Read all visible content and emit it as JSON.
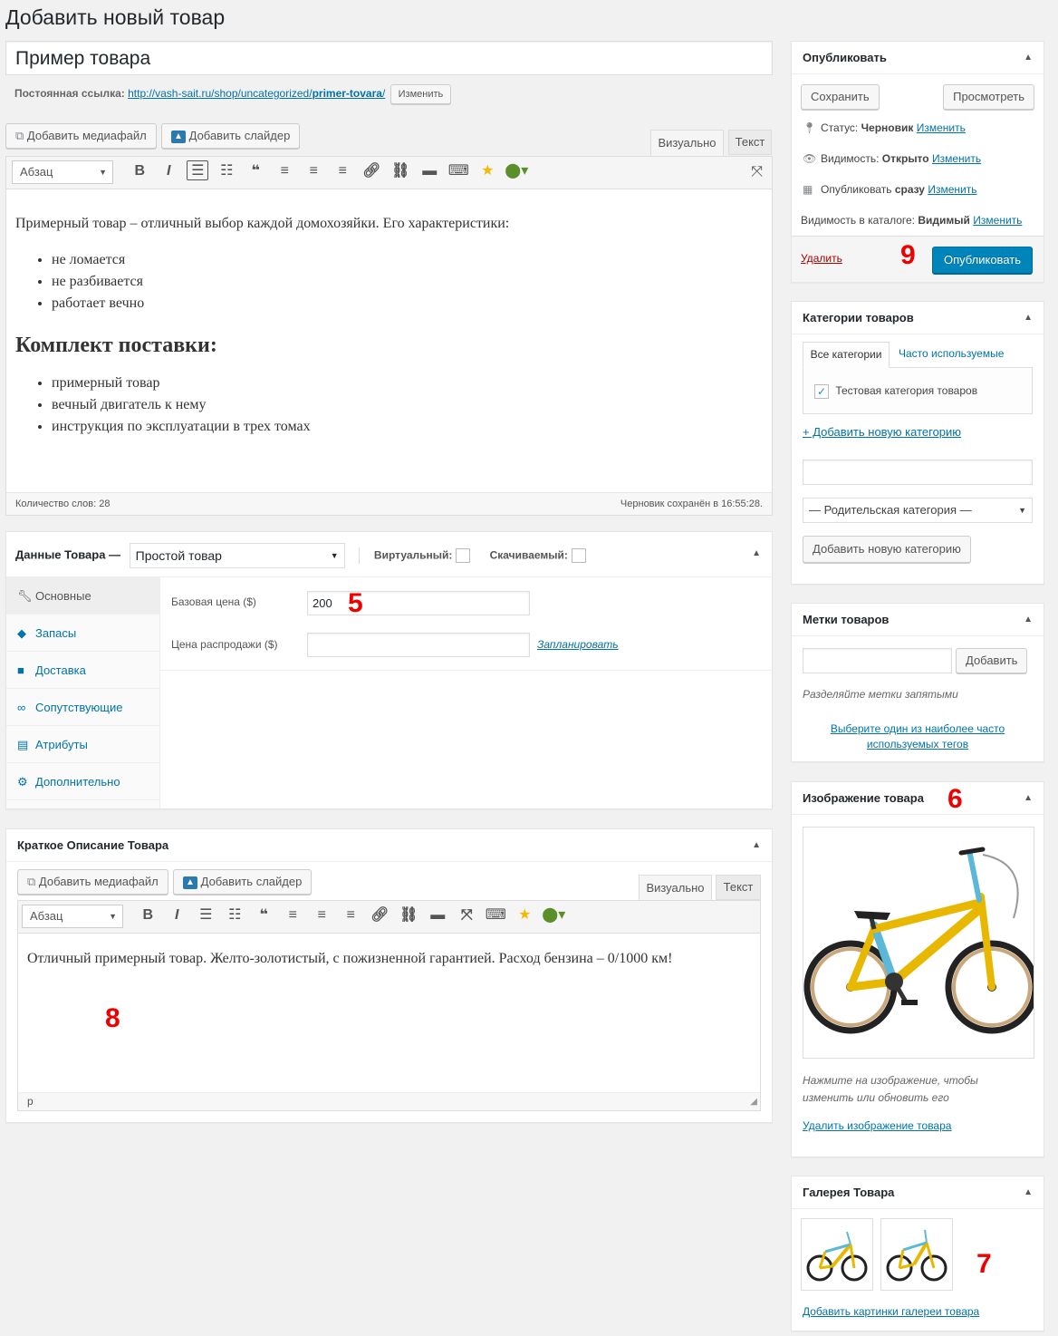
{
  "page": {
    "title": "Добавить новый товар"
  },
  "post": {
    "title_value": "Пример товара",
    "permalink_label": "Постоянная ссылка:",
    "permalink_base": "http://vash-sait.ru/shop/uncategorized/",
    "permalink_slug": "primer-tovara",
    "permalink_end": "/",
    "change_button": "Изменить"
  },
  "editor": {
    "add_media": "Добавить медиафайл",
    "add_slider": "Добавить слайдер",
    "tab_visual": "Визуально",
    "tab_text": "Текст",
    "format_select": "Абзац",
    "intro": "Примерный товар – отличный выбор каждой домохозяйки. Его характеристики:",
    "features": [
      "не ломается",
      "не разбивается",
      "работает вечно"
    ],
    "heading": "Комплект поставки:",
    "package": [
      "примерный товар",
      "вечный двигатель к нему",
      "инструкция по эксплуатации в трех томах"
    ],
    "word_count": "Количество слов: 28",
    "saved_status": "Черновик сохранён в 16:55:28."
  },
  "product_data": {
    "label": "Данные Товара —",
    "type_select": "Простой товар",
    "virtual_label": "Виртуальный:",
    "downloadable_label": "Скачиваемый:",
    "tabs": [
      {
        "label": "Основные",
        "icon": "wrench-icon"
      },
      {
        "label": "Запасы",
        "icon": "tag-icon"
      },
      {
        "label": "Доставка",
        "icon": "truck-icon"
      },
      {
        "label": "Сопутствующие",
        "icon": "link-icon"
      },
      {
        "label": "Атрибуты",
        "icon": "list-icon"
      },
      {
        "label": "Дополнительно",
        "icon": "gear-icon"
      }
    ],
    "regular_price_label": "Базовая цена ($)",
    "regular_price_value": "200",
    "sale_price_label": "Цена распродажи ($)",
    "sale_price_value": "",
    "schedule_link": "Запланировать"
  },
  "short_desc": {
    "title": "Краткое Описание Товара",
    "add_media": "Добавить медиафайл",
    "add_slider": "Добавить слайдер",
    "tab_visual": "Визуально",
    "tab_text": "Текст",
    "format_select": "Абзац",
    "content": "Отличный примерный товар. Желто-золотистый, с пожизненной гарантией. Расход бензина – 0/1000 км!",
    "path": "p"
  },
  "publish": {
    "title": "Опубликовать",
    "save_button": "Сохранить",
    "preview_button": "Просмотреть",
    "status_label": "Статус:",
    "status_value": "Черновик",
    "visibility_label": "Видимость:",
    "visibility_value": "Открыто",
    "publish_label": "Опубликовать",
    "publish_value": "сразу",
    "catalog_label": "Видимость в каталоге:",
    "catalog_value": "Видимый",
    "edit_link": "Изменить",
    "delete_link": "Удалить",
    "publish_button": "Опубликовать"
  },
  "categories": {
    "title": "Категории товаров",
    "tab_all": "Все категории",
    "tab_popular": "Часто используемые",
    "items": [
      {
        "label": "Тестовая категория товаров",
        "checked": true
      }
    ],
    "add_link": "+ Добавить новую категорию",
    "new_category_value": "",
    "parent_select": "— Родительская категория —",
    "add_button": "Добавить новую категорию"
  },
  "tags": {
    "title": "Метки товаров",
    "input_value": "",
    "add_button": "Добавить",
    "hint": "Разделяйте метки запятыми",
    "choose_link": "Выберите один из наиболее часто используемых тегов"
  },
  "product_image": {
    "title": "Изображение товара",
    "hint": "Нажмите на изображение, чтобы изменить или обновить его",
    "remove_link": "Удалить изображение товара"
  },
  "gallery": {
    "title": "Галерея Товара",
    "add_link": "Добавить картинки галереи товара"
  },
  "annotations": {
    "n5": "5",
    "n6": "6",
    "n7": "7",
    "n8": "8",
    "n9": "9"
  },
  "colors": {
    "accent": "#0085ba",
    "link": "#0073aa",
    "delete": "#a00",
    "annotation": "#e00000"
  }
}
